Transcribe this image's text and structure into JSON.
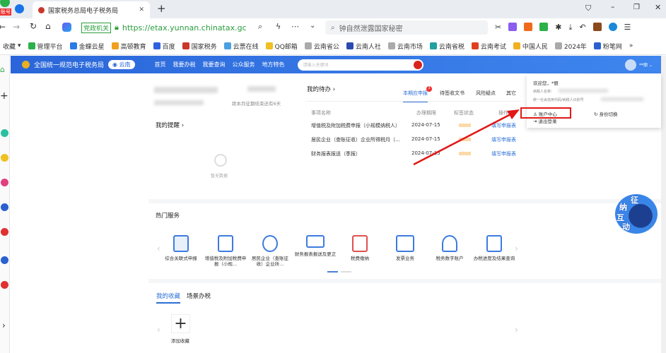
{
  "browser": {
    "tab_title": "国家税务总局电子税务局",
    "url": "https://etax.yunnan.chinatax.gc",
    "site_badge": "党政机关",
    "search_text": "钟自然泄露国家秘密",
    "corner_badge": "账号"
  },
  "bookmarks": [
    "收藏",
    "管理平台",
    "金蝶云星",
    "高顿教育",
    "百度",
    "国家税务",
    "云票在线",
    "QQ邮箱",
    "云南省公",
    "云南人社",
    "云南市场",
    "云南省税",
    "云南考试",
    "中国人民",
    "2024年",
    "粉笔网"
  ],
  "header": {
    "title": "全国统一规范电子税务局",
    "region": "云南",
    "nav": [
      "首页",
      "我要办税",
      "我要查询",
      "公众服务",
      "地方特色"
    ],
    "search_placeholder": "请输入关键词",
    "user": "**丽"
  },
  "left": {
    "deadline": "距本月征期结束还有6天",
    "reminder_title": "我的提醒 ›",
    "empty": "暂无数据"
  },
  "todo": {
    "title": "我的待办 ›",
    "tabs": [
      "本期应申报",
      "待签收文书",
      "风险疑点",
      "其它"
    ],
    "badge": "3",
    "columns": [
      "事项名称",
      "办理期限",
      "标签状态",
      "操作"
    ],
    "rows": [
      {
        "name": "增值税及附加税费申报（小规模纳税人）",
        "date": "2024-07-15",
        "action": "填写申报表"
      },
      {
        "name": "居民企业（查账征收）企业所得税月（...",
        "date": "2024-07-15",
        "action": "填写申报表"
      },
      {
        "name": "财务报表报送（季报）",
        "date": "2024-07-15",
        "action": "填写申报表"
      }
    ]
  },
  "popup": {
    "welcome": "欢迎您，*丽",
    "name_label": "纳税人名称：",
    "id_label": "统一社会信用代码/纳税人识别号",
    "account": "账户中心",
    "switch": "身份切换",
    "logout": "退出登录"
  },
  "hot": {
    "title": "热门服务",
    "items": [
      "综合关联式申报",
      "增值税及附加税费申报（小规...",
      "居民企业（查账征收）企业所...",
      "财务报表报送及更正",
      "税费缴纳",
      "发票业务",
      "税务数字账户",
      "办税进度及结果查询"
    ]
  },
  "fav": {
    "tabs": [
      "我的收藏",
      "场景办税"
    ],
    "add": "添加收藏"
  },
  "mascot": {
    "text": [
      "征",
      "纳",
      "互",
      "动"
    ]
  }
}
